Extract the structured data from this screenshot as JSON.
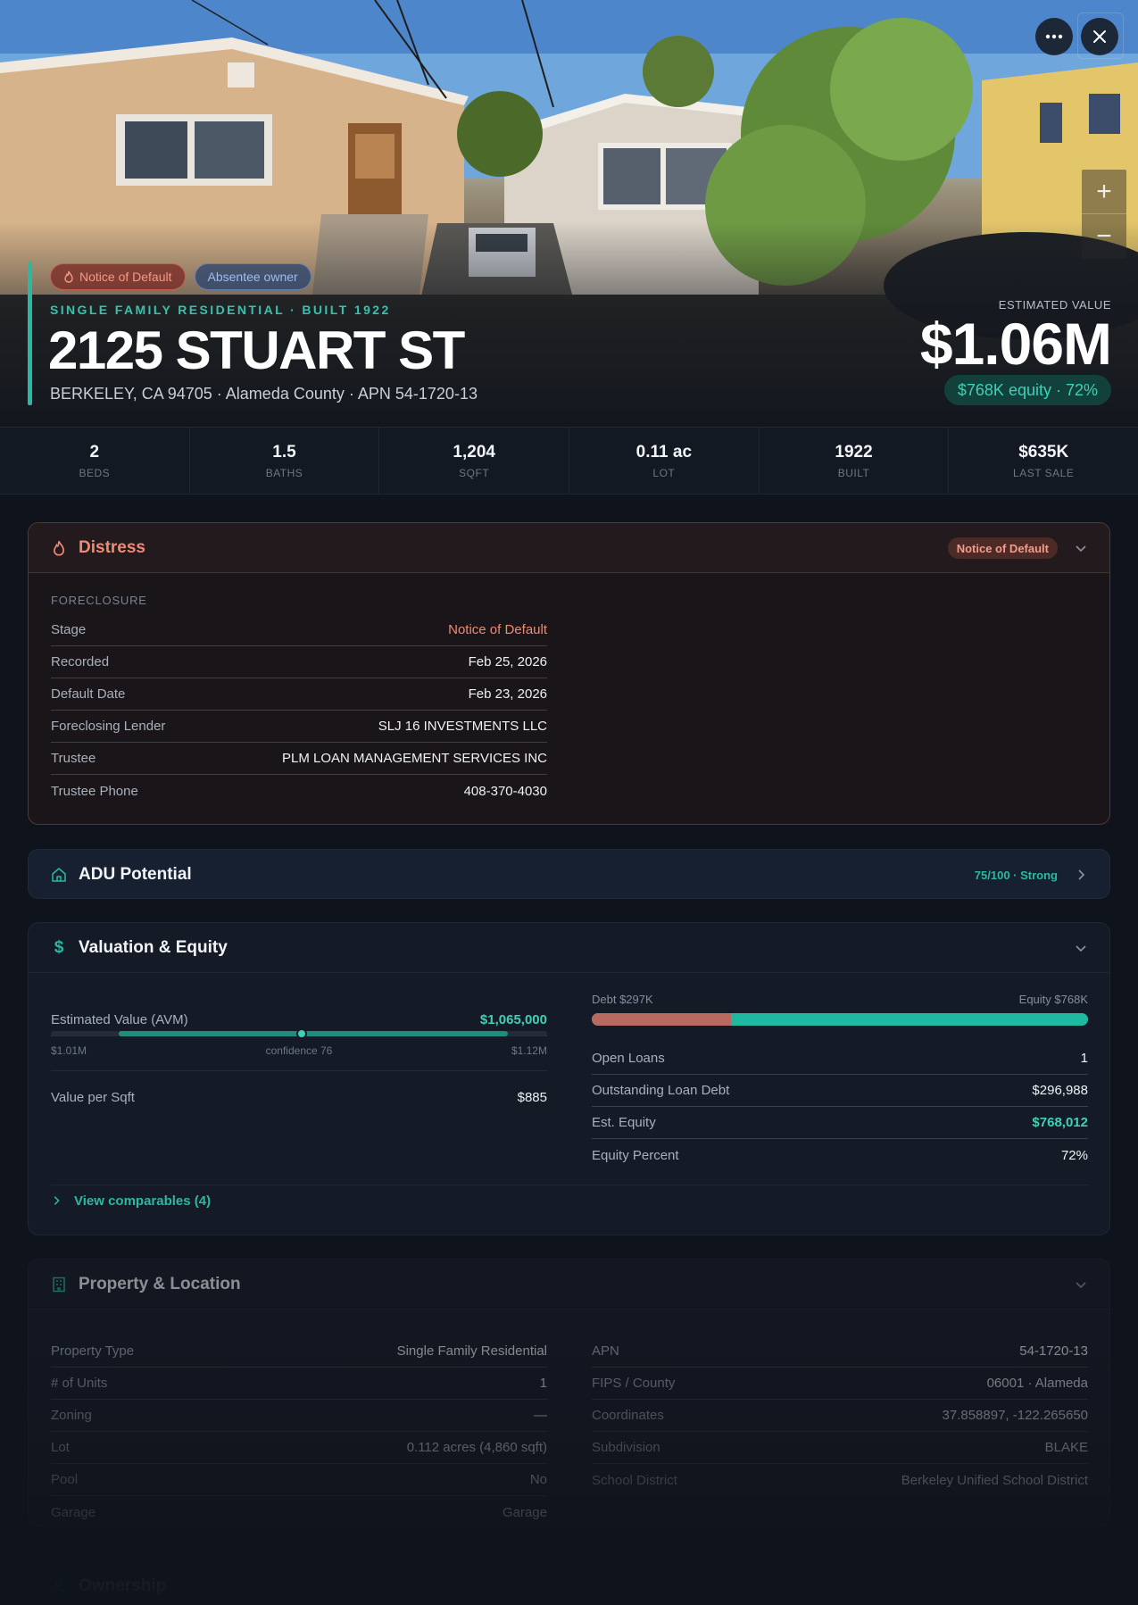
{
  "hero": {
    "tags": [
      "Notice of Default",
      "Absentee owner"
    ],
    "kicker": "SINGLE FAMILY RESIDENTIAL · BUILT 1922",
    "address": "2125 STUART ST",
    "subaddress": "BERKELEY, CA 94705 · Alameda County · APN 54-1720-13",
    "est_label": "ESTIMATED VALUE",
    "est_value": "$1.06M",
    "equity_pill": "$768K equity · 72%",
    "zoom_in": "+",
    "zoom_out": "−"
  },
  "stats": [
    {
      "value": "2",
      "label": "BEDS"
    },
    {
      "value": "1.5",
      "label": "BATHS"
    },
    {
      "value": "1,204",
      "label": "SQFT"
    },
    {
      "value": "0.11 ac",
      "label": "LOT"
    },
    {
      "value": "1922",
      "label": "BUILT"
    },
    {
      "value": "$635K",
      "label": "LAST SALE"
    }
  ],
  "distress": {
    "title": "Distress",
    "badge": "Notice of Default",
    "section": "FORECLOSURE",
    "rows": [
      {
        "k": "Stage",
        "v": "Notice of Default"
      },
      {
        "k": "Recorded",
        "v": "Feb 25, 2026"
      },
      {
        "k": "Default Date",
        "v": "Feb 23, 2026"
      },
      {
        "k": "Foreclosing Lender",
        "v": "SLJ 16 INVESTMENTS LLC"
      },
      {
        "k": "Trustee",
        "v": "PLM LOAN MANAGEMENT SERVICES INC"
      },
      {
        "k": "Trustee Phone",
        "v": "408-370-4030"
      }
    ]
  },
  "adu": {
    "title": "ADU Potential",
    "score": "75/100 · Strong"
  },
  "valuation": {
    "title": "Valuation & Equity",
    "avm_label": "Estimated Value (AVM)",
    "avm_value": "$1,065,000",
    "range_low": "$1.01M",
    "confidence": "confidence 76",
    "confidence_fraction": 0.76,
    "range_high": "$1.12M",
    "per_sqft_label": "Value per Sqft",
    "per_sqft_value": "$885",
    "debt_label": "Debt $297K",
    "equity_label": "Equity $768K",
    "debt_fraction": 0.28,
    "rows": [
      {
        "k": "Open Loans",
        "v": "1"
      },
      {
        "k": "Outstanding Loan Debt",
        "v": "$296,988"
      },
      {
        "k": "Est. Equity",
        "v": "$768,012"
      },
      {
        "k": "Equity Percent",
        "v": "72%"
      }
    ],
    "comps_link": "View comparables (4)"
  },
  "property": {
    "title": "Property & Location",
    "left": [
      {
        "k": "Property Type",
        "v": "Single Family Residential"
      },
      {
        "k": "# of Units",
        "v": "1"
      },
      {
        "k": "Zoning",
        "v": "—"
      },
      {
        "k": "Lot",
        "v": "0.112 acres (4,860 sqft)"
      },
      {
        "k": "Pool",
        "v": "No"
      },
      {
        "k": "Garage",
        "v": "Garage"
      }
    ],
    "right": [
      {
        "k": "APN",
        "v": "54-1720-13"
      },
      {
        "k": "FIPS / County",
        "v": "06001 · Alameda"
      },
      {
        "k": "Coordinates",
        "v": "37.858897, -122.265650"
      },
      {
        "k": "Subdivision",
        "v": "BLAKE"
      },
      {
        "k": "School District",
        "v": "Berkeley Unified School District"
      }
    ]
  },
  "ownership": {
    "title": "Ownership"
  },
  "colors": {
    "accent": "#2bb8a3",
    "distress": "#f08a74",
    "debt": "#b86a60",
    "equity": "#1fb9a2"
  }
}
